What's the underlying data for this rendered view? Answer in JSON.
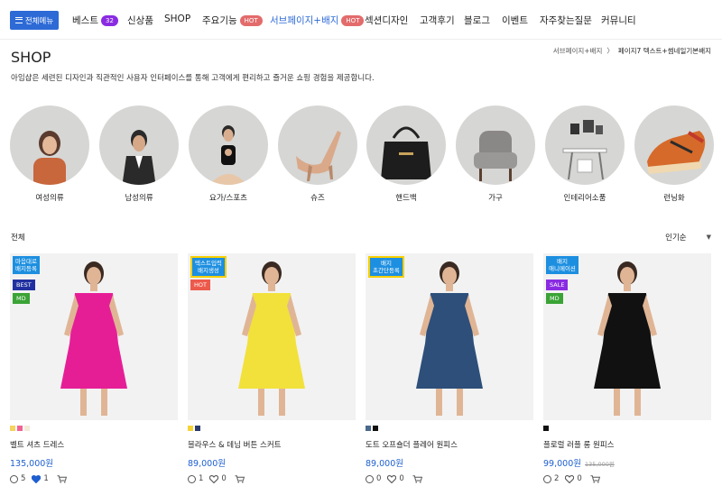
{
  "nav": {
    "menu_button": "전체메뉴",
    "items": [
      {
        "label": "베스트",
        "badge": "32",
        "badge_color": "#8a2be2"
      },
      {
        "label": "신상품"
      },
      {
        "label": "SHOP"
      },
      {
        "label": "주요기능",
        "badge": "HOT",
        "badge_color": "#e36b6b"
      },
      {
        "label": "서브페이지+배지",
        "badge": "HOT",
        "badge_color": "#e36b6b",
        "active": true
      },
      {
        "label": "섹션디자인"
      },
      {
        "label": "고객후기"
      },
      {
        "label": "블로그"
      },
      {
        "label": "이벤트"
      },
      {
        "label": "자주찾는질문"
      },
      {
        "label": "커뮤니티"
      }
    ]
  },
  "page": {
    "title": "SHOP",
    "description": "아임샵은 세련된 디자인과 직관적인 사용자 인터페이스를 통해 고객에게 편리하고 즐거운 쇼핑 경험을 제공합니다.",
    "breadcrumb": [
      "서브페이지+배지",
      "페이지7 텍스트+썸네일기본배지"
    ],
    "breadcrumb_sep": "〉"
  },
  "categories": [
    {
      "label": "여성의류",
      "icon": "woman-photo"
    },
    {
      "label": "남성의류",
      "icon": "man-photo"
    },
    {
      "label": "요가/스포츠",
      "icon": "yoga-photo"
    },
    {
      "label": "슈즈",
      "icon": "heels-photo"
    },
    {
      "label": "핸드백",
      "icon": "handbag-photo"
    },
    {
      "label": "가구",
      "icon": "armchair-photo"
    },
    {
      "label": "인테리어소품",
      "icon": "desk-photo"
    },
    {
      "label": "런닝화",
      "icon": "sneaker-photo"
    }
  ],
  "filter": {
    "label": "전체",
    "sort": "인기순"
  },
  "products": [
    {
      "name": "벨트 셔츠 드레스",
      "price": "135,000원",
      "tag": "마음대로\n배지등록",
      "tag_style": "blue",
      "badges": [
        {
          "text": "BEST",
          "color": "#2030a0"
        },
        {
          "text": "MD",
          "color": "#3aa335"
        }
      ],
      "swatches": [
        "#f4d35e",
        "#f06292",
        "#f3ead8"
      ],
      "comments": "5",
      "likes": "1",
      "liked": true,
      "dress": "#e61e96"
    },
    {
      "name": "블라우스 & 데님 버튼 스커트",
      "price": "89,000원",
      "tag": "텍스트입력\n배지생성",
      "tag_style": "yellow",
      "badges": [
        {
          "text": "HOT",
          "color": "#ec5a4c"
        }
      ],
      "swatches": [
        "#f4d338",
        "#2b3b6a"
      ],
      "comments": "1",
      "likes": "0",
      "liked": false,
      "dress": "#f2e13a"
    },
    {
      "name": "도트 오프숄더 플레어 원피스",
      "price": "89,000원",
      "tag": "배지\n초간단등록",
      "tag_style": "yellow",
      "badges": [],
      "swatches": [
        "#4a6a8a",
        "#111"
      ],
      "comments": "0",
      "likes": "0",
      "liked": false,
      "dress": "#2d4f7a"
    },
    {
      "name": "플로럴 러플 롱 원피스",
      "price": "99,000원",
      "old_price": "135,000원",
      "tag": "배지\n애니메이션",
      "tag_style": "blue",
      "badges": [
        {
          "text": "SALE",
          "color": "#8a2be2"
        },
        {
          "text": "MD",
          "color": "#3aa335"
        }
      ],
      "swatches": [
        "#111"
      ],
      "comments": "2",
      "likes": "0",
      "liked": false,
      "dress": "#111"
    }
  ]
}
